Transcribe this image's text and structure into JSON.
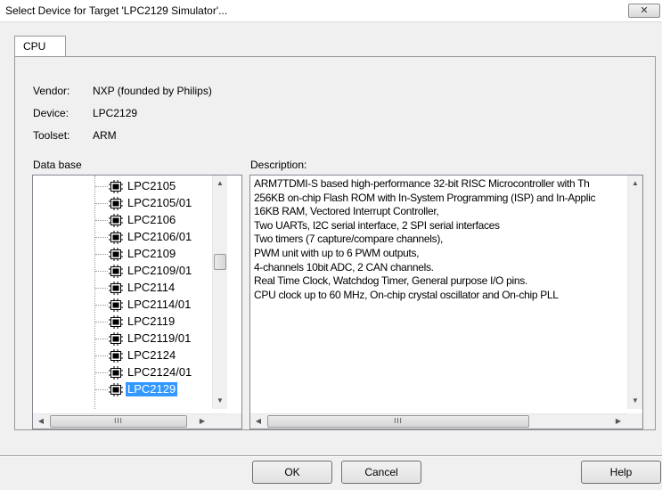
{
  "window": {
    "title": "Select Device for Target 'LPC2129 Simulator'...",
    "close_label": "✕"
  },
  "tabs": [
    {
      "label": "CPU",
      "active": true
    }
  ],
  "info": {
    "vendor_label": "Vendor:",
    "vendor_value": "NXP (founded by Philips)",
    "device_label": "Device:",
    "device_value": "LPC2129",
    "toolset_label": "Toolset:",
    "toolset_value": "ARM"
  },
  "database": {
    "label": "Data base",
    "items": [
      {
        "label": "LPC2105"
      },
      {
        "label": "LPC2105/01"
      },
      {
        "label": "LPC2106"
      },
      {
        "label": "LPC2106/01"
      },
      {
        "label": "LPC2109"
      },
      {
        "label": "LPC2109/01"
      },
      {
        "label": "LPC2114"
      },
      {
        "label": "LPC2114/01"
      },
      {
        "label": "LPC2119"
      },
      {
        "label": "LPC2119/01"
      },
      {
        "label": "LPC2124"
      },
      {
        "label": "LPC2124/01"
      },
      {
        "label": "LPC2129",
        "selected": true
      }
    ],
    "scroll_up": "▲",
    "scroll_down": "▼",
    "scroll_left": "◀",
    "scroll_right": "▶",
    "hthumb_grip": "III"
  },
  "description": {
    "label": "Description:",
    "lines": [
      "ARM7TDMI-S based high-performance 32-bit RISC Microcontroller with Th",
      "256KB on-chip Flash ROM with In-System Programming (ISP) and In-Applic",
      "16KB RAM, Vectored Interrupt Controller,",
      "Two UARTs, I2C serial interface,  2 SPI serial interfaces",
      "Two timers  (7 capture/compare channels),",
      "PWM unit with up to 6 PWM outputs,",
      "4-channels 10bit ADC, 2 CAN channels.",
      "Real Time Clock, Watchdog Timer, General purpose I/O pins.",
      "CPU clock up to 60 MHz, On-chip crystal oscillator and On-chip PLL"
    ],
    "scroll_up": "▲",
    "scroll_down": "▼",
    "scroll_left": "◀",
    "scroll_right": "▶",
    "hthumb_grip": "III"
  },
  "buttons": {
    "ok": "OK",
    "cancel": "Cancel",
    "help": "Help"
  },
  "colors": {
    "selection": "#3399ff"
  },
  "icons": {
    "device": "chip-icon"
  }
}
